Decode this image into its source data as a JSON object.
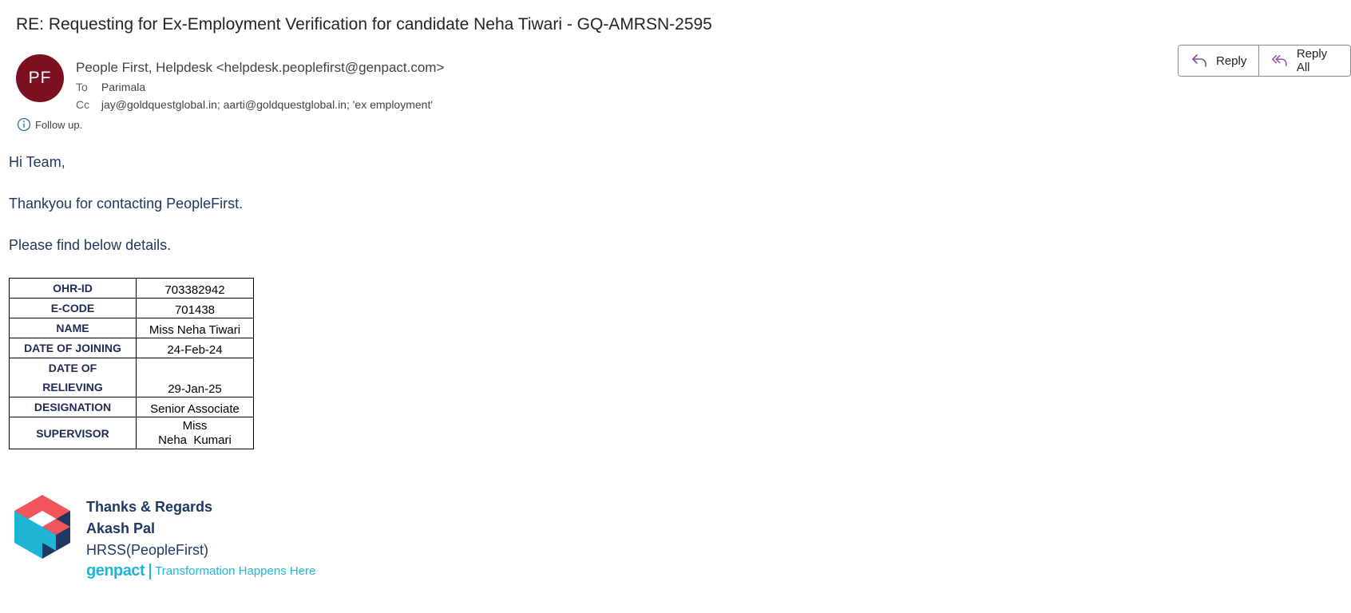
{
  "email": {
    "subject": "RE: Requesting for Ex-Employment Verification for candidate Neha Tiwari - GQ-AMRSN-2595",
    "avatar_initials": "PF",
    "avatar_color": "#7a1020",
    "sender": "People First, Helpdesk <helpdesk.peoplefirst@genpact.com>",
    "to_label": "To",
    "to_value": "Parimala",
    "cc_label": "Cc",
    "cc_value": "jay@goldquestglobal.in; aarti@goldquestglobal.in; 'ex employment'",
    "followup_icon": "info-icon",
    "followup_text": "Follow up."
  },
  "actions": {
    "reply_label": "Reply",
    "reply_all_label": "Reply All",
    "reply_icon": "reply-arrow-icon",
    "reply_all_icon": "reply-all-arrow-icon"
  },
  "body": {
    "greeting": "Hi Team,",
    "line1": "Thankyou for contacting PeopleFirst.",
    "line2": "Please find below details."
  },
  "details_table": {
    "rows": [
      {
        "key": "OHR-ID",
        "value": "703382942"
      },
      {
        "key": "E-CODE",
        "value": "701438"
      },
      {
        "key": "NAME",
        "value": "Miss Neha Tiwari"
      },
      {
        "key": "DATE OF JOINING",
        "value": "24-Feb-24"
      },
      {
        "key_line1": "DATE OF",
        "key_line2": "RELIEVING",
        "value": "29-Jan-25"
      },
      {
        "key": "DESIGNATION",
        "value": "Senior Associate"
      },
      {
        "key": "SUPERVISOR",
        "value_line1": "Miss",
        "value_line2": "Neha  Kumari"
      }
    ]
  },
  "signature": {
    "thanks": "Thanks & Regards",
    "name": "Akash Pal",
    "role": "HRSS(PeopleFirst)",
    "brand": "genpact",
    "tagline": "Transformation Happens Here",
    "logo_icon": "genpact-logo-icon",
    "text_color": "#1f3864",
    "brand_color": "#1fb6d6"
  }
}
